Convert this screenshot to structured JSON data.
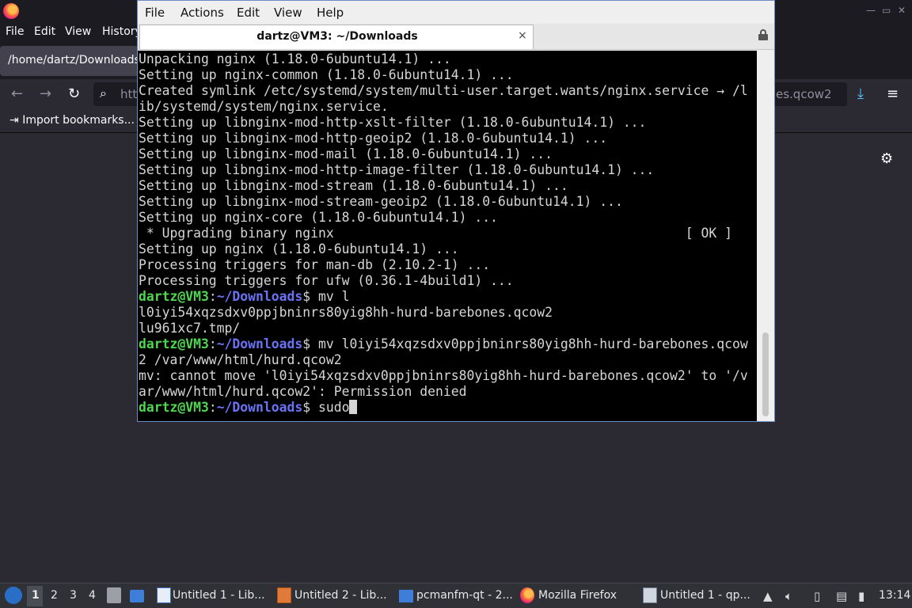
{
  "firefox": {
    "menu": [
      "File",
      "Edit",
      "View",
      "History"
    ],
    "tab_title": "/home/dartz/Downloads/",
    "url_left": "htt",
    "url_right": "es.qcow2",
    "bookmark_label": "Import bookmarks..."
  },
  "terminal": {
    "menu": [
      "File",
      "Actions",
      "Edit",
      "View",
      "Help"
    ],
    "tab_title": "dartz@VM3: ~/Downloads",
    "tab_close": "×",
    "output": [
      "Unpacking nginx (1.18.0-6ubuntu14.1) ...",
      "Setting up nginx-common (1.18.0-6ubuntu14.1) ...",
      "Created symlink /etc/systemd/system/multi-user.target.wants/nginx.service → /l",
      "ib/systemd/system/nginx.service.",
      "Setting up libnginx-mod-http-xslt-filter (1.18.0-6ubuntu14.1) ...",
      "Setting up libnginx-mod-http-geoip2 (1.18.0-6ubuntu14.1) ...",
      "Setting up libnginx-mod-mail (1.18.0-6ubuntu14.1) ...",
      "Setting up libnginx-mod-http-image-filter (1.18.0-6ubuntu14.1) ...",
      "Setting up libnginx-mod-stream (1.18.0-6ubuntu14.1) ...",
      "Setting up libnginx-mod-stream-geoip2 (1.18.0-6ubuntu14.1) ...",
      "Setting up nginx-core (1.18.0-6ubuntu14.1) ...",
      " * Upgrading binary nginx                                             [ OK ]",
      "Setting up nginx (1.18.0-6ubuntu14.1) ...",
      "Processing triggers for man-db (2.10.2-1) ...",
      "Processing triggers for ufw (0.36.1-4build1) ..."
    ],
    "prompt_user": "dartz@VM3",
    "prompt_sep": ":",
    "prompt_path": "~/Downloads",
    "prompt_dollar": "$ ",
    "cmd1": "mv l",
    "cmd1_wrap": [
      "l0iyi54xqzsdxv0ppjbninrs80yig8hh-hurd-barebones.qcow2",
      "lu961xc7.tmp/"
    ],
    "cmd2": "mv l0iyi54xqzsdxv0ppjbninrs80yig8hh-hurd-barebones.qcow",
    "cmd2_wrap": "2 /var/www/html/hurd.qcow2",
    "error": [
      "mv: cannot move 'l0iyi54xqzsdxv0ppjbninrs80yig8hh-hurd-barebones.qcow2' to '/v",
      "ar/www/html/hurd.qcow2': Permission denied"
    ],
    "cmd3": "sudo"
  },
  "taskbar": {
    "desktops": [
      "1",
      "2",
      "3",
      "4"
    ],
    "tasks": [
      "Untitled 1 - Lib...",
      "Untitled 2 - Lib...",
      "pcmanfm-qt - 2...",
      "Mozilla Firefox",
      "Untitled 1 - qp..."
    ],
    "clock": "13:14"
  }
}
